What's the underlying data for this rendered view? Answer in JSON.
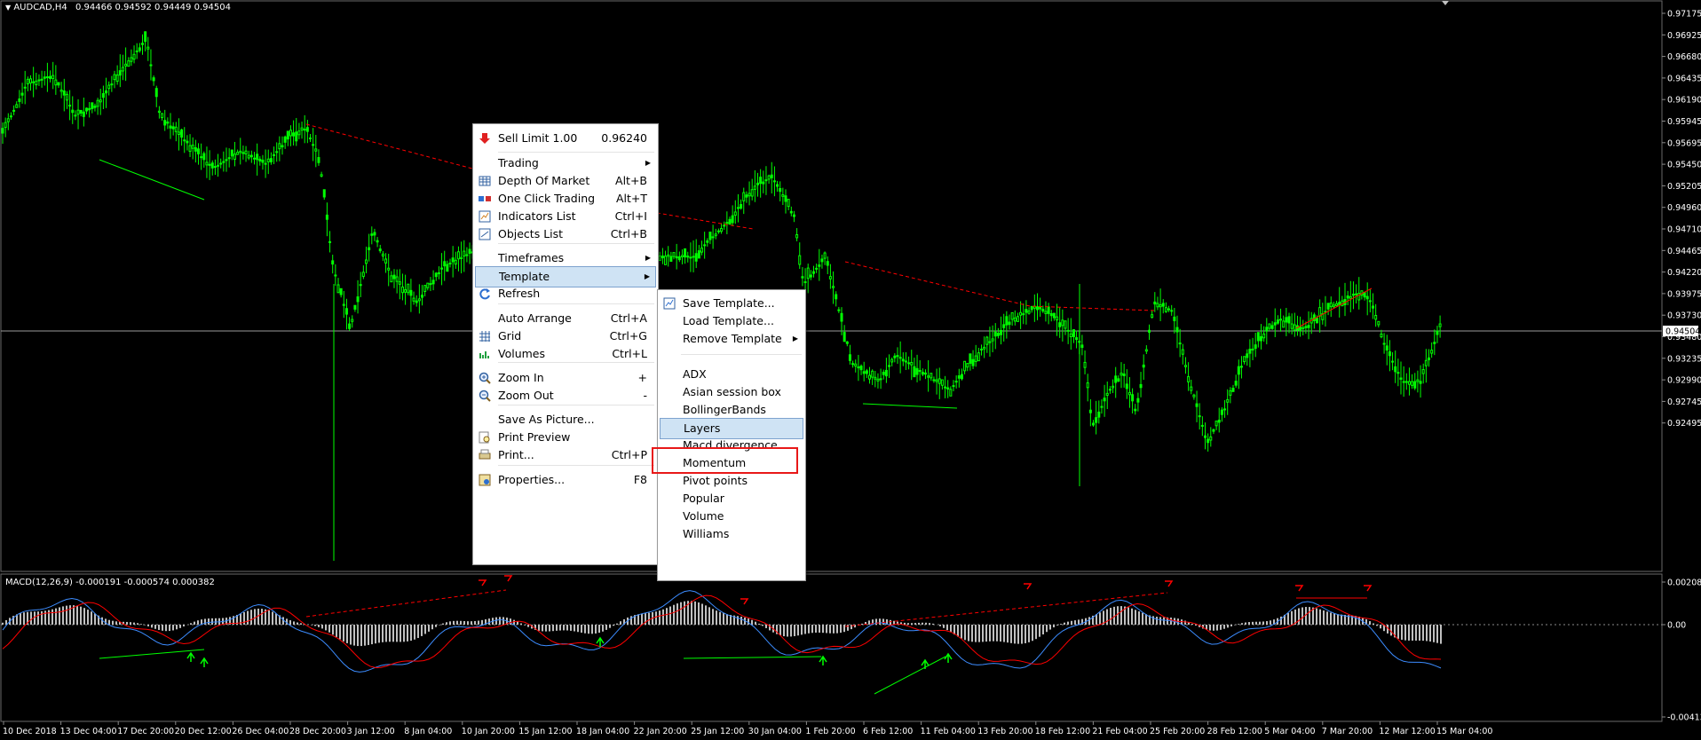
{
  "chart_header": {
    "symbol_timeframe": "AUDCAD,H4",
    "ohlc": "0.94466 0.94592 0.94449 0.94504"
  },
  "price_axis": {
    "ticks": [
      "0.97175",
      "0.96925",
      "0.96680",
      "0.96435",
      "0.96190",
      "0.95945",
      "0.95695",
      "0.95450",
      "0.95205",
      "0.94960",
      "0.94710",
      "0.94465",
      "0.94220",
      "0.93975",
      "0.93730",
      "0.93480",
      "0.93235",
      "0.92990",
      "0.92745",
      "0.92495"
    ],
    "current_price": "0.94504"
  },
  "macd_panel": {
    "label": "MACD(12,26,9) -0.000191 -0.000574 0.000382",
    "ticks": [
      "0.002085",
      "0.00",
      "-0.004136"
    ]
  },
  "time_axis": {
    "ticks": [
      "10 Dec 2018",
      "13 Dec 04:00",
      "17 Dec 20:00",
      "20 Dec 12:00",
      "26 Dec 04:00",
      "28 Dec 20:00",
      "3 Jan 12:00",
      "8 Jan 04:00",
      "10 Jan 20:00",
      "15 Jan 12:00",
      "18 Jan 04:00",
      "22 Jan 20:00",
      "25 Jan 12:00",
      "30 Jan 04:00",
      "1 Feb 20:00",
      "6 Feb 12:00",
      "11 Feb 04:00",
      "13 Feb 20:00",
      "18 Feb 12:00",
      "21 Feb 04:00",
      "25 Feb 20:00",
      "28 Feb 12:00",
      "5 Mar 04:00",
      "7 Mar 20:00",
      "12 Mar 12:00",
      "15 Mar 04:00"
    ]
  },
  "context_menu": {
    "sell_limit": {
      "label": "Sell Limit 1.00",
      "price": "0.96240",
      "icon": "red-down-arrow-icon"
    },
    "items": [
      {
        "label": "Trading",
        "shortcut": "",
        "submenu": true,
        "icon": ""
      },
      {
        "label": "Depth Of Market",
        "shortcut": "Alt+B",
        "icon": "depth-of-market-icon"
      },
      {
        "label": "One Click Trading",
        "shortcut": "Alt+T",
        "icon": "one-click-trading-icon"
      },
      {
        "label": "Indicators List",
        "shortcut": "Ctrl+I",
        "icon": "indicators-list-icon"
      },
      {
        "label": "Objects List",
        "shortcut": "Ctrl+B",
        "icon": "objects-list-icon"
      },
      {
        "label": "Timeframes",
        "shortcut": "",
        "submenu": true,
        "icon": ""
      },
      {
        "label": "Template",
        "shortcut": "",
        "submenu": true,
        "highlighted": true,
        "icon": ""
      },
      {
        "label": "Refresh",
        "shortcut": "",
        "icon": "refresh-icon"
      },
      {
        "label": "Auto Arrange",
        "shortcut": "Ctrl+A",
        "icon": ""
      },
      {
        "label": "Grid",
        "shortcut": "Ctrl+G",
        "icon": "grid-icon"
      },
      {
        "label": "Volumes",
        "shortcut": "Ctrl+L",
        "icon": "volumes-icon"
      },
      {
        "label": "Zoom In",
        "shortcut": "+",
        "icon": "zoom-in-icon"
      },
      {
        "label": "Zoom Out",
        "shortcut": "-",
        "icon": "zoom-out-icon"
      },
      {
        "label": "Save As Picture...",
        "shortcut": "",
        "icon": ""
      },
      {
        "label": "Print Preview",
        "shortcut": "",
        "icon": "print-preview-icon"
      },
      {
        "label": "Print...",
        "shortcut": "Ctrl+P",
        "icon": "print-icon"
      },
      {
        "label": "Properties...",
        "shortcut": "F8",
        "icon": "properties-icon"
      }
    ]
  },
  "template_submenu": {
    "items": [
      {
        "label": "Save Template...",
        "icon": "save-template-icon"
      },
      {
        "label": "Load Template..."
      },
      {
        "label": "Remove Template",
        "submenu": true
      },
      {
        "label": "ADX"
      },
      {
        "label": "Asian session box"
      },
      {
        "label": "BollingerBands"
      },
      {
        "label": "Layers",
        "highlighted": true
      },
      {
        "label": "Macd divergence",
        "boxed": true
      },
      {
        "label": "Momentum"
      },
      {
        "label": "Pivot points"
      },
      {
        "label": "Popular"
      },
      {
        "label": "Volume"
      },
      {
        "label": "Williams"
      }
    ]
  },
  "colors": {
    "background": "#000000",
    "candles": "#00ff00",
    "divergence_bearish": "#ff0000",
    "divergence_bullish": "#00ff00",
    "macd_main": "#3c8cff",
    "macd_signal": "#ff0000",
    "macd_histogram": "#c0c0c0",
    "menu_highlight": "#cfe3f4"
  }
}
